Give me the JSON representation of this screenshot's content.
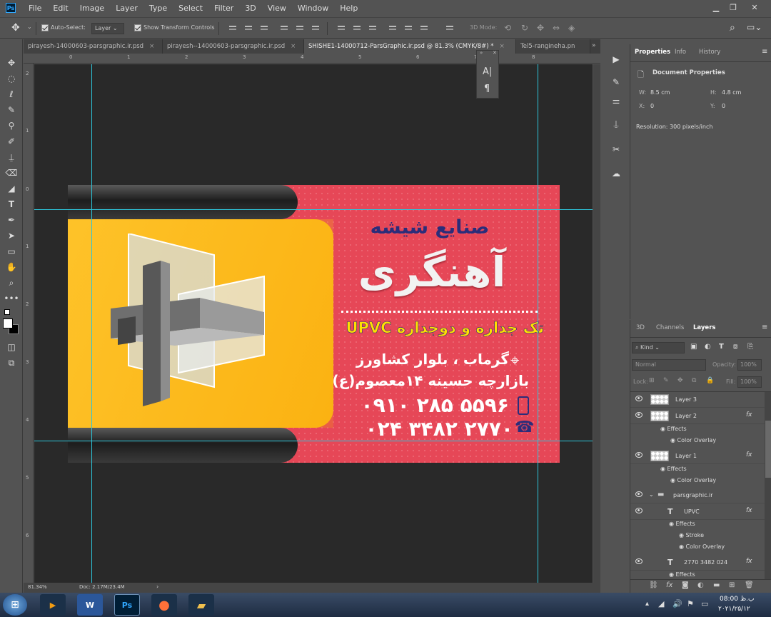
{
  "app": {
    "logo": "Ps"
  },
  "menu": [
    "File",
    "Edit",
    "Image",
    "Layer",
    "Type",
    "Select",
    "Filter",
    "3D",
    "View",
    "Window",
    "Help"
  ],
  "options": {
    "auto_select_label": "Auto-Select:",
    "auto_select_value": "Layer",
    "show_transform_label": "Show Transform Controls",
    "mode_3d_label": "3D Mode:"
  },
  "tabs": [
    {
      "label": "pirayesh-14000603-parsgraphic.ir.psd",
      "close": "×"
    },
    {
      "label": "pirayesh--14000603-parsgraphic.ir.psd",
      "close": "×"
    },
    {
      "label": "SHISHE1-14000712-ParsGraphic.ir.psd @ 81.3% (CMYK/8#) *",
      "close": "×"
    },
    {
      "label": "Tel5-rangineha.pn",
      "close": ""
    }
  ],
  "ruler_h": [
    "0",
    "1",
    "2",
    "3",
    "4",
    "5",
    "6",
    "7",
    "8"
  ],
  "ruler_v": [
    "2",
    "1",
    "0",
    "1",
    "2",
    "3",
    "4",
    "5",
    "6"
  ],
  "status": {
    "zoom": "81.34%",
    "doc": "Doc: 2.17M/23.4M"
  },
  "card": {
    "brand_small": "صنایع شیشه",
    "brand_big": "آهنگری",
    "tagline": "تک جداره و دوجداره UPVC",
    "address1": "گرماب ، بلوار کشاورز",
    "address2": "بازارچه حسینه ۱۴معصوم(ع)",
    "mobile": "۰۹۱۰ ۲۸۵ ۵۵۹۶",
    "phone": "۰۲۴ ۳۴۸۲ ۲۷۷۰",
    "colors": {
      "red": "#e64757",
      "yellow": "#fdb814",
      "navy": "#2b2d7a",
      "highlight": "#ffe100"
    }
  },
  "properties": {
    "tabs": [
      "Properties",
      "Info",
      "History"
    ],
    "doc_label": "Document Properties",
    "w_label": "W:",
    "w_value": "8.5 cm",
    "h_label": "H:",
    "h_value": "4.8 cm",
    "x_label": "X:",
    "x_value": "0",
    "y_label": "Y:",
    "y_value": "0",
    "resolution": "Resolution: 300 pixels/inch"
  },
  "layers_panel": {
    "tabs": [
      "3D",
      "Channels",
      "Layers"
    ],
    "kind": "Kind",
    "blend": "Normal",
    "opacity_label": "Opacity:",
    "opacity_value": "100%",
    "lock_label": "Lock:",
    "fill_label": "Fill:",
    "fill_value": "100%",
    "rows": [
      {
        "name": "Layer 3",
        "type": "layer",
        "fx": ""
      },
      {
        "name": "Layer 2",
        "type": "layer",
        "fx": "fx"
      },
      {
        "name": "Effects",
        "type": "effects",
        "fx": ""
      },
      {
        "name": "Color Overlay",
        "type": "effect",
        "fx": ""
      },
      {
        "name": "Layer 1",
        "type": "layer",
        "fx": "fx"
      },
      {
        "name": "Effects",
        "type": "effects",
        "fx": ""
      },
      {
        "name": "Color Overlay",
        "type": "effect",
        "fx": ""
      },
      {
        "name": "parsgraphic.ir",
        "type": "group",
        "fx": ""
      },
      {
        "name": "UPVC",
        "type": "text",
        "fx": "fx"
      },
      {
        "name": "Effects",
        "type": "effects",
        "fx": ""
      },
      {
        "name": "Stroke",
        "type": "effect",
        "fx": ""
      },
      {
        "name": "Color Overlay",
        "type": "effect",
        "fx": ""
      },
      {
        "name": "2770 3482 024",
        "type": "text",
        "fx": "fx"
      },
      {
        "name": "Effects",
        "type": "effects",
        "fx": ""
      }
    ]
  },
  "taskbar": {
    "time": "08:00 ب.ظ",
    "date": "۲۰۲۱/۲۵/۱۲"
  }
}
